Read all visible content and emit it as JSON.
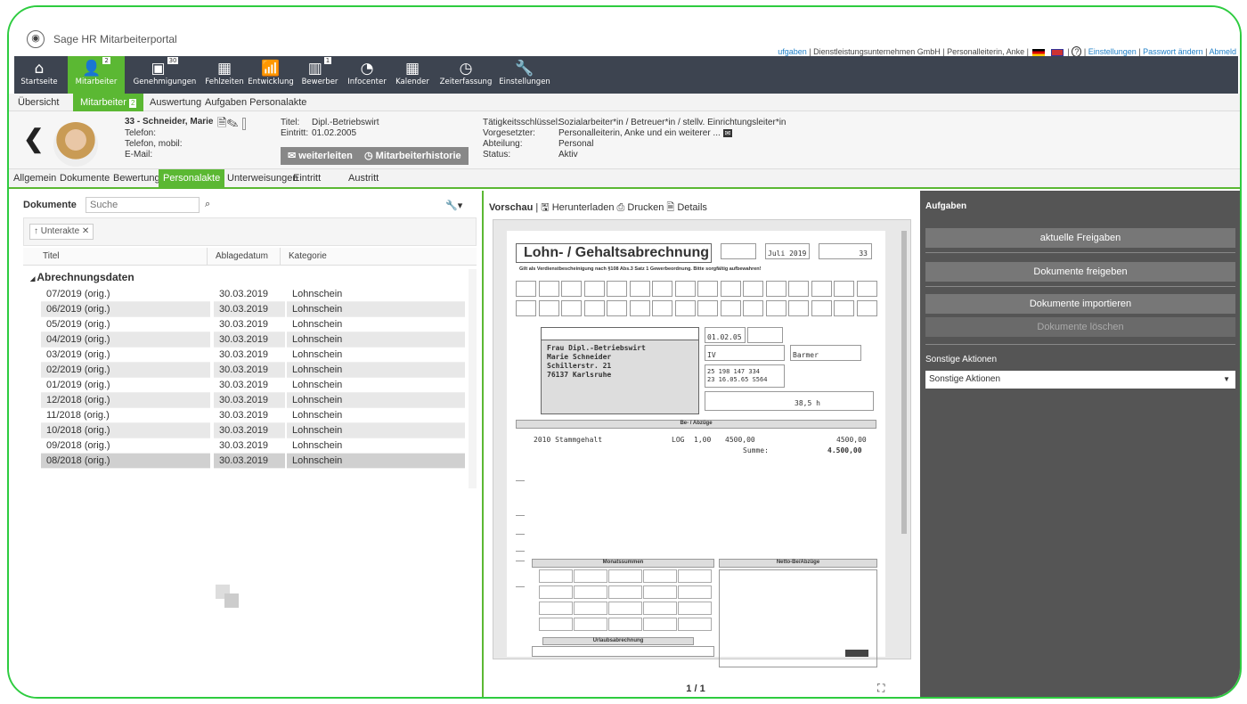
{
  "app": {
    "title": "Sage HR Mitarbeiterportal"
  },
  "toplinks": {
    "tasks": "ufgaben",
    "company": "| Dienstleistungsunternehmen GmbH | Personalleiterin, Anke |",
    "help": "?",
    "settings": "Einstellungen",
    "password": "Passwort ändern",
    "logout": "Abmeld"
  },
  "nav": [
    {
      "label": "Startseite",
      "icon": "home-icon",
      "glyph": "⌂"
    },
    {
      "label": "Mitarbeiter",
      "icon": "person-icon",
      "glyph": "👤",
      "badge": "2"
    },
    {
      "label": "Genehmigungen",
      "icon": "approval-icon",
      "glyph": "▣",
      "badge": "30"
    },
    {
      "label": "Fehlzeiten",
      "icon": "calendar-icon",
      "glyph": "▦"
    },
    {
      "label": "Entwicklung",
      "icon": "chart-icon",
      "glyph": "📶"
    },
    {
      "label": "Bewerber",
      "icon": "applicant-icon",
      "glyph": "▥",
      "badge": "1"
    },
    {
      "label": "Infocenter",
      "icon": "pie-icon",
      "glyph": "◔"
    },
    {
      "label": "Kalender",
      "icon": "calendar-icon",
      "glyph": "▦"
    },
    {
      "label": "Zeiterfassung",
      "icon": "clock-icon",
      "glyph": "◷"
    },
    {
      "label": "Einstellungen",
      "icon": "wrench-icon",
      "glyph": "🔧"
    }
  ],
  "subnav": [
    {
      "label": "Übersicht"
    },
    {
      "label": "Mitarbeiter",
      "badge": "2"
    },
    {
      "label": "Auswertung"
    },
    {
      "label": "Aufgaben Personalakte"
    }
  ],
  "employee": {
    "name": "33 - Schneider, Marie",
    "phone_label": "Telefon:",
    "mobile_label": "Telefon, mobil:",
    "email_label": "E-Mail:",
    "title_label": "Titel:",
    "title_value": "Dipl.-Betriebswirt",
    "entry_label": "Eintritt:",
    "entry_value": "01.02.2005",
    "forward_label": "weiterleiten",
    "history_label": "Mitarbeiterhistorie",
    "activity_label": "Tätigkeitsschlüssel:",
    "activity_value": "Sozialarbeiter*in / Betreuer*in / stellv. Einrichtungsleiter*in",
    "manager_label": "Vorgesetzter:",
    "manager_value": "Personalleiterin, Anke und ein weiterer ...",
    "dept_label": "Abteilung:",
    "dept_value": "Personal",
    "status_label": "Status:",
    "status_value": "Aktiv"
  },
  "tabs": [
    "Allgemein",
    "Dokumente",
    "Bewertung",
    "Personalakte",
    "Unterweisungen",
    "Eintritt",
    "Austritt"
  ],
  "documents": {
    "label": "Dokumente",
    "search_placeholder": "Suche",
    "filter_chip": "↑ Unterakte ✕",
    "columns": [
      "Titel",
      "Ablagedatum",
      "Kategorie"
    ],
    "group": "Abrechnungsdaten",
    "rows": [
      {
        "title": "07/2019 (orig.)",
        "date": "30.03.2019",
        "cat": "Lohnschein"
      },
      {
        "title": "06/2019 (orig.)",
        "date": "30.03.2019",
        "cat": "Lohnschein"
      },
      {
        "title": "05/2019 (orig.)",
        "date": "30.03.2019",
        "cat": "Lohnschein"
      },
      {
        "title": "04/2019 (orig.)",
        "date": "30.03.2019",
        "cat": "Lohnschein"
      },
      {
        "title": "03/2019 (orig.)",
        "date": "30.03.2019",
        "cat": "Lohnschein"
      },
      {
        "title": "02/2019 (orig.)",
        "date": "30.03.2019",
        "cat": "Lohnschein"
      },
      {
        "title": "01/2019 (orig.)",
        "date": "30.03.2019",
        "cat": "Lohnschein"
      },
      {
        "title": "12/2018 (orig.)",
        "date": "30.03.2019",
        "cat": "Lohnschein"
      },
      {
        "title": "11/2018 (orig.)",
        "date": "30.03.2019",
        "cat": "Lohnschein"
      },
      {
        "title": "10/2018 (orig.)",
        "date": "30.03.2019",
        "cat": "Lohnschein"
      },
      {
        "title": "09/2018 (orig.)",
        "date": "30.03.2019",
        "cat": "Lohnschein"
      },
      {
        "title": "08/2018 (orig.)",
        "date": "30.03.2019",
        "cat": "Lohnschein"
      }
    ]
  },
  "preview": {
    "label": "Vorschau",
    "download": "Herunterladen",
    "print": "Drucken",
    "details": "Details",
    "pager": "1 / 1",
    "doc": {
      "title": "Lohn- / Gehaltsabrechnung",
      "subtitle": "Gilt als Verdienstbescheinigung nach §108 Abs.3 Satz 1 Gewerbeordnung. Bitte sorgfältig aufbewahren!",
      "period": "Juli 2019",
      "persnr": "33",
      "address": [
        "Frau Dipl.-Betriebswirt",
        "Marie Schneider",
        "Schillerstr. 21",
        "76137 Karlsruhe"
      ],
      "entry_date": "01.02.05",
      "tax_class": "IV",
      "insurance": "Barmer",
      "svnr": "23 16.05.65 S564",
      "tax_id": "25 198 147 334",
      "hours": "38,5 h",
      "section": "Be- / Abzüge",
      "line_code": "2010",
      "line_text": "Stammgehalt",
      "line_type": "LOG",
      "line_qty": "1,00",
      "line_amount": "4500,00",
      "line_total": "4500,00",
      "sum_label": "Summe:",
      "sum_value": "4.500,00",
      "monthly": "Monatssummen",
      "net": "Netto-Be/Abzüge",
      "vacation": "Urlaubsabrechnung"
    }
  },
  "tasks": {
    "title": "Aufgaben",
    "btn_current": "aktuelle Freigaben",
    "btn_release": "Dokumente freigeben",
    "btn_import": "Dokumente importieren",
    "btn_delete": "Dokumente löschen",
    "other_label": "Sonstige Aktionen",
    "other_select": "Sonstige Aktionen"
  }
}
